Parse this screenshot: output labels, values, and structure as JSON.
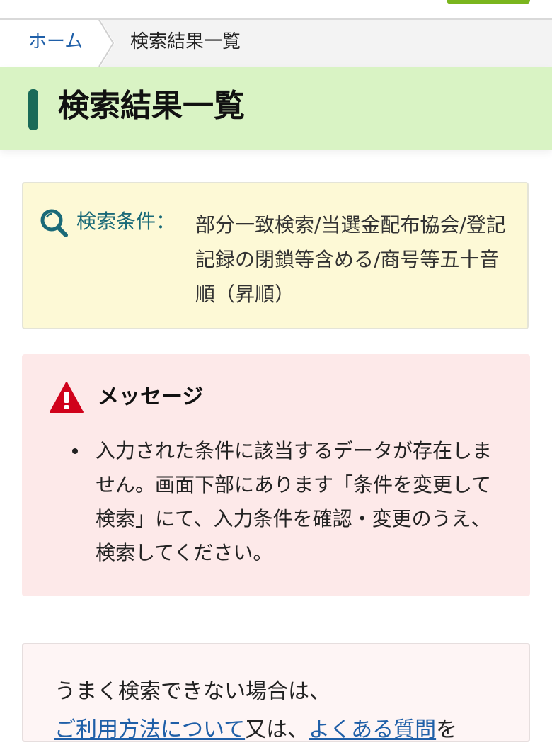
{
  "breadcrumb": {
    "home": "ホーム",
    "current": "検索結果一覧"
  },
  "page_title": "検索結果一覧",
  "conditions": {
    "label": "検索条件：",
    "text": "部分一致検索/当選金配布協会/登記記録の閉鎖等含める/商号等五十音順（昇順）",
    "icon": "search-icon"
  },
  "message": {
    "title": "メッセージ",
    "icon": "warning-icon",
    "items": [
      "入力された条件に該当するデータが存在しません。画面下部にあります「条件を変更して検索」にて、入力条件を確認・変更のうえ、検索してください。"
    ]
  },
  "help": {
    "intro": "うまく検索できない場合は、",
    "link1": "ご利用方法について",
    "conj": "又は、",
    "link2": "よくある質問",
    "suffix": "を"
  },
  "colors": {
    "accent_green": "#7ab51d",
    "title_band": "#d9f3c4",
    "title_bar": "#1a6a58",
    "conditions_bg": "#fdf9d6",
    "message_bg": "#fde9e9",
    "link": "#1f5fa8",
    "warning": "#d0021b"
  }
}
